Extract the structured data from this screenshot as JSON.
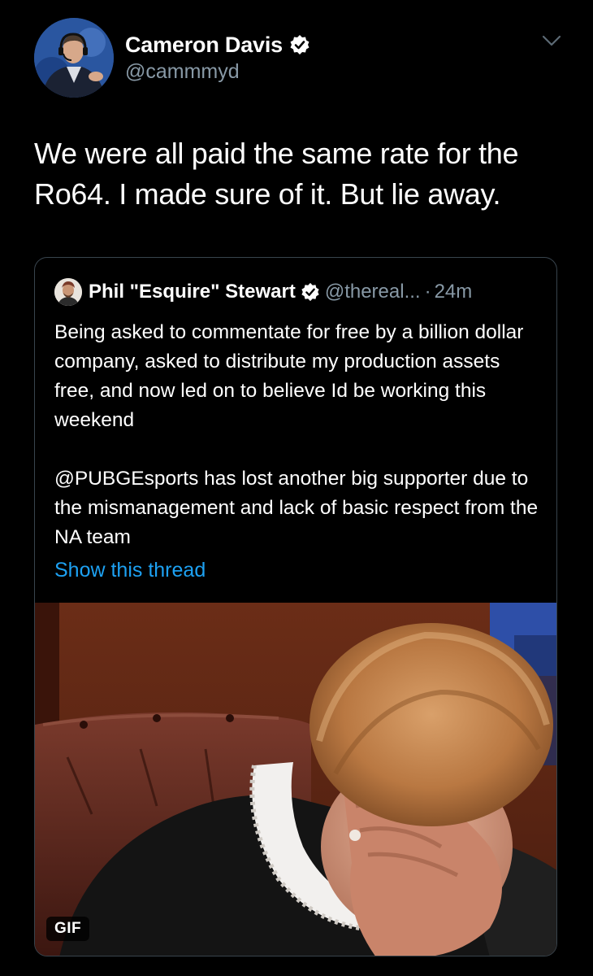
{
  "tweet": {
    "author": {
      "name": "Cameron Davis",
      "handle": "@cammmyd",
      "verified": true
    },
    "text": "We were all paid the same rate for the Ro64. I made sure of it. But lie away."
  },
  "quoted_tweet": {
    "author": {
      "name": "Phil \"Esquire\" Stewart",
      "handle": "@thereal...",
      "verified": true
    },
    "separator": "·",
    "time": "24m",
    "paragraphs": [
      "Being asked to commentate for free by a billion dollar company, asked to distribute my production assets free, and now led on to believe Id be working this weekend",
      "@PUBGEsports has lost another big supporter due to the mismanagement and lack of basic respect from the NA team"
    ],
    "show_thread": "Show this thread",
    "media_badge": "GIF"
  },
  "colors": {
    "background": "#000000",
    "text": "#ffffff",
    "secondary": "#8899a6",
    "link": "#1da1f2",
    "border": "#38444d"
  },
  "icons": [
    "verified-badge-icon",
    "chevron-down-icon"
  ]
}
